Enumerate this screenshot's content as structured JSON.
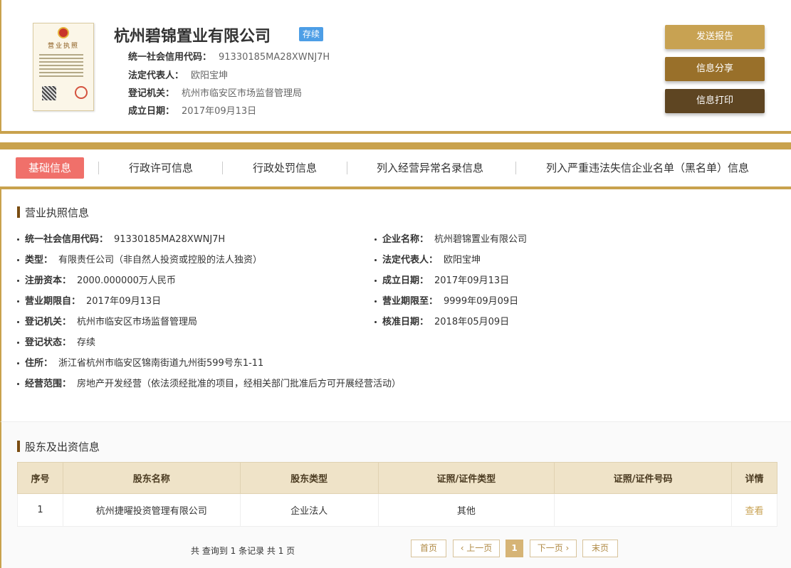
{
  "company": {
    "name": "杭州碧锦置业有限公司",
    "status": "存续",
    "license_title": "营业执照",
    "fields": [
      {
        "label": "统一社会信用代码：",
        "value": "91330185MA28XWNJ7H"
      },
      {
        "label": "法定代表人：",
        "value": "欧阳宝坤"
      },
      {
        "label": "登记机关：",
        "value": "杭州市临安区市场监督管理局"
      },
      {
        "label": "成立日期：",
        "value": "2017年09月13日"
      }
    ]
  },
  "actions": {
    "send_report": "发送报告",
    "share": "信息分享",
    "print": "信息打印"
  },
  "tabs": [
    {
      "label": "基础信息",
      "active": true
    },
    {
      "label": "行政许可信息"
    },
    {
      "label": "行政处罚信息"
    },
    {
      "label": "列入经营异常名录信息"
    },
    {
      "label": "列入严重违法失信企业名单（黑名单）信息"
    }
  ],
  "license_section": {
    "title": "营业执照信息",
    "left": [
      {
        "label": "统一社会信用代码：",
        "value": "91330185MA28XWNJ7H"
      },
      {
        "label": "类型：",
        "value": "有限责任公司（非自然人投资或控股的法人独资）"
      },
      {
        "label": "注册资本：",
        "value": "2000.000000万人民币"
      },
      {
        "label": "营业期限自：",
        "value": "2017年09月13日"
      },
      {
        "label": "登记机关：",
        "value": "杭州市临安区市场监督管理局"
      },
      {
        "label": "登记状态：",
        "value": "存续"
      },
      {
        "label": "住所：",
        "value": "浙江省杭州市临安区锦南街道九州街599号东1-11"
      },
      {
        "label": "经营范围：",
        "value": "房地产开发经营（依法须经批准的项目，经相关部门批准后方可开展经营活动）"
      }
    ],
    "right": [
      {
        "label": "企业名称：",
        "value": "杭州碧锦置业有限公司"
      },
      {
        "label": "法定代表人：",
        "value": "欧阳宝坤"
      },
      {
        "label": "成立日期：",
        "value": "2017年09月13日"
      },
      {
        "label": "营业期限至：",
        "value": "9999年09月09日"
      },
      {
        "label": "核准日期：",
        "value": "2018年05月09日"
      }
    ]
  },
  "shareholders": {
    "title": "股东及出资信息",
    "columns": [
      "序号",
      "股东名称",
      "股东类型",
      "证照/证件类型",
      "证照/证件号码",
      "详情"
    ],
    "rows": [
      {
        "no": "1",
        "name": "杭州捷曜投资管理有限公司",
        "type": "企业法人",
        "cert_type": "其他",
        "cert_no": "",
        "detail": "查看"
      }
    ],
    "summary": "共 查询到 1 条记录 共 1 页",
    "pager": {
      "first": "首页",
      "prev": "‹ 上一页",
      "current": "1",
      "next": "下一页 ›",
      "last": "末页"
    }
  }
}
